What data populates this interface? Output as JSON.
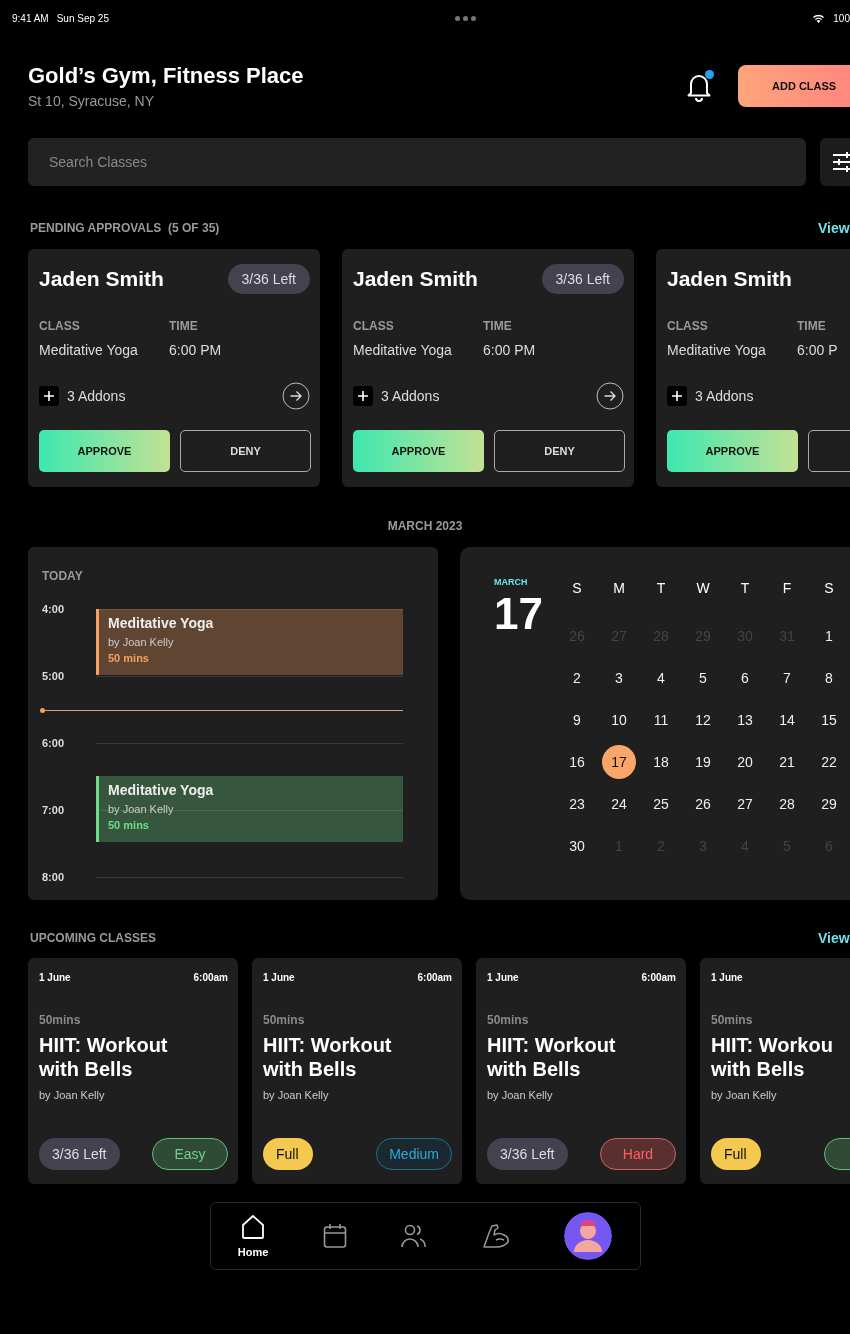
{
  "status_bar": {
    "time": "9:41 AM",
    "date": "Sun Sep 25",
    "battery": "100"
  },
  "header": {
    "title": "Gold’s Gym, Fitness Place",
    "subtitle": "St 10, Syracuse, NY",
    "has_unread_notifications": true,
    "add_button": "ADD CLASS"
  },
  "search": {
    "placeholder": "Search Classes"
  },
  "pending": {
    "title": "PENDING APPROVALS  (5 OF 35)",
    "view_link": "View",
    "cards": [
      {
        "name": "Jaden Smith",
        "badge": "3/36 Left",
        "class_label": "CLASS",
        "class_value": "Meditative Yoga",
        "time_label": "TIME",
        "time_value": "6:00 PM",
        "addons": "3 Addons",
        "has_arrow": true,
        "actions": [
          {
            "kind": "approve",
            "label": "APPROVE"
          },
          {
            "kind": "deny",
            "label": "DENY"
          }
        ]
      },
      {
        "name": "Jaden Smith",
        "badge": "3/36 Left",
        "class_label": "CLASS",
        "class_value": "Meditative Yoga",
        "time_label": "TIME",
        "time_value": "6:00 PM",
        "addons": "3 Addons",
        "has_arrow": true,
        "actions": [
          {
            "kind": "approve",
            "label": "APPROVE"
          },
          {
            "kind": "deny",
            "label": "DENY"
          }
        ]
      },
      {
        "name": "Jaden Smith",
        "class_label": "CLASS",
        "class_value": "Meditative Yoga",
        "time_label": "TIME",
        "time_value": "6:00 P",
        "addons": "3 Addons",
        "actions": [
          {
            "kind": "approve",
            "label": "APPROVE"
          },
          {
            "kind": "deny"
          }
        ]
      }
    ]
  },
  "schedule": {
    "title": "MARCH 2023",
    "today": {
      "label": "TODAY",
      "hours": [
        {
          "time": "4:00",
          "event_half_past": false,
          "event": {
            "title": "Meditative Yoga",
            "by": "by Joan Kelly",
            "duration": "50 mins",
            "color": "#f5a060"
          }
        },
        {
          "time": "5:00",
          "now_marker": true
        },
        {
          "time": "6:00",
          "event_half_past": true,
          "event": {
            "title": "Meditative Yoga",
            "by": "by Joan Kelly",
            "duration": "50 mins",
            "color": "#6cdc86"
          }
        },
        {
          "time": "7:00"
        },
        {
          "time": "8:00"
        }
      ]
    },
    "calendar": {
      "month": "MARCH",
      "day": "17",
      "weekdays": [
        "S",
        "M",
        "T",
        "W",
        "T",
        "F",
        "S"
      ],
      "weeks": [
        [
          {
            "day": "26",
            "in_month": false,
            "selected": false
          },
          {
            "day": "27",
            "in_month": false,
            "selected": false
          },
          {
            "day": "28",
            "in_month": false,
            "selected": false
          },
          {
            "day": "29",
            "in_month": false,
            "selected": false
          },
          {
            "day": "30",
            "in_month": false,
            "selected": false
          },
          {
            "day": "31",
            "in_month": false,
            "selected": false
          },
          {
            "day": "1",
            "in_month": true,
            "selected": false
          }
        ],
        [
          {
            "day": "2",
            "in_month": true,
            "selected": false
          },
          {
            "day": "3",
            "in_month": true,
            "selected": false
          },
          {
            "day": "4",
            "in_month": true,
            "selected": false
          },
          {
            "day": "5",
            "in_month": true,
            "selected": false
          },
          {
            "day": "6",
            "in_month": true,
            "selected": false
          },
          {
            "day": "7",
            "in_month": true,
            "selected": false
          },
          {
            "day": "8",
            "in_month": true,
            "selected": false
          }
        ],
        [
          {
            "day": "9",
            "in_month": true,
            "selected": false
          },
          {
            "day": "10",
            "in_month": true,
            "selected": false
          },
          {
            "day": "11",
            "in_month": true,
            "selected": false
          },
          {
            "day": "12",
            "in_month": true,
            "selected": false
          },
          {
            "day": "13",
            "in_month": true,
            "selected": false
          },
          {
            "day": "14",
            "in_month": true,
            "selected": false
          },
          {
            "day": "15",
            "in_month": true,
            "selected": false
          }
        ],
        [
          {
            "day": "16",
            "in_month": true,
            "selected": false
          },
          {
            "day": "17",
            "in_month": true,
            "selected": true
          },
          {
            "day": "18",
            "in_month": true,
            "selected": false
          },
          {
            "day": "19",
            "in_month": true,
            "selected": false
          },
          {
            "day": "20",
            "in_month": true,
            "selected": false
          },
          {
            "day": "21",
            "in_month": true,
            "selected": false
          },
          {
            "day": "22",
            "in_month": true,
            "selected": false
          }
        ],
        [
          {
            "day": "23",
            "in_month": true,
            "selected": false
          },
          {
            "day": "24",
            "in_month": true,
            "selected": false
          },
          {
            "day": "25",
            "in_month": true,
            "selected": false
          },
          {
            "day": "26",
            "in_month": true,
            "selected": false
          },
          {
            "day": "27",
            "in_month": true,
            "selected": false
          },
          {
            "day": "28",
            "in_month": true,
            "selected": false
          },
          {
            "day": "29",
            "in_month": true,
            "selected": false
          }
        ],
        [
          {
            "day": "30",
            "in_month": true,
            "selected": false
          },
          {
            "day": "1",
            "in_month": false,
            "selected": false
          },
          {
            "day": "2",
            "in_month": false,
            "selected": false
          },
          {
            "day": "3",
            "in_month": false,
            "selected": false
          },
          {
            "day": "4",
            "in_month": false,
            "selected": false
          },
          {
            "day": "5",
            "in_month": false,
            "selected": false
          },
          {
            "day": "6",
            "in_month": false,
            "selected": false
          }
        ]
      ]
    }
  },
  "upcoming": {
    "title": "UPCOMING CLASSES",
    "view_link": "View",
    "cards": [
      {
        "date": "1 June",
        "time": "6:00am",
        "duration": "50mins",
        "title_lines": [
          "HIIT: Workout",
          "with Bells"
        ],
        "by": "by Joan Kelly",
        "tags": [
          {
            "kind": "spots",
            "label": "3/36 Left"
          },
          {
            "kind": "easy",
            "label": "Easy"
          }
        ]
      },
      {
        "date": "1 June",
        "time": "6:00am",
        "duration": "50mins",
        "title_lines": [
          "HIIT: Workout",
          "with Bells"
        ],
        "by": "by Joan Kelly",
        "tags": [
          {
            "kind": "full",
            "label": "Full"
          },
          {
            "kind": "medium",
            "label": "Medium"
          }
        ]
      },
      {
        "date": "1 June",
        "time": "6:00am",
        "duration": "50mins",
        "title_lines": [
          "HIIT: Workout",
          "with Bells"
        ],
        "by": "by Joan Kelly",
        "tags": [
          {
            "kind": "spots",
            "label": "3/36 Left"
          },
          {
            "kind": "hard",
            "label": "Hard"
          }
        ]
      },
      {
        "date": "1 June",
        "duration": "50mins",
        "title_lines": [
          "HIIT: Workou",
          "with Bells"
        ],
        "by": "by Joan Kelly",
        "tags": [
          {
            "kind": "full",
            "label": "Full"
          },
          {
            "kind": "easy"
          }
        ]
      }
    ]
  },
  "nav": [
    {
      "kind": "home",
      "label": "Home",
      "selected": true
    },
    {
      "kind": "calendar",
      "selected": false
    },
    {
      "kind": "people",
      "selected": false
    },
    {
      "kind": "muscle",
      "selected": false
    },
    {
      "kind": "avatar",
      "selected": false
    }
  ]
}
